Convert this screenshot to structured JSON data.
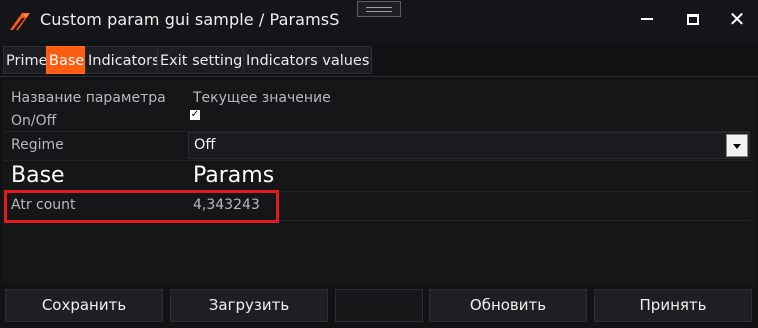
{
  "window": {
    "title": "Custom param gui sample / ParamsS",
    "colors": {
      "accent": "#ff5c11",
      "background": "#111214",
      "highlight_border": "#e11b20"
    },
    "icons": [
      "app-logo-icon",
      "drag-handle-icon",
      "minimize-icon",
      "maximize-icon",
      "close-icon"
    ]
  },
  "tabs": [
    {
      "label": "Prime",
      "active": false
    },
    {
      "label": "Base",
      "active": true
    },
    {
      "label": "Indicators",
      "active": false
    },
    {
      "label": "Exit settings",
      "active": false
    },
    {
      "label": "Indicators values",
      "active": false
    }
  ],
  "parameters": {
    "headers": {
      "name": "Название параметра",
      "value": "Текущее значение"
    },
    "on_off": {
      "label": "On/Off",
      "checked": true,
      "check_mark": "✓"
    },
    "regime": {
      "label": "Regime",
      "value": "Off"
    },
    "group": {
      "label": "Base",
      "value": "Params"
    },
    "atr_count": {
      "label": "Atr count",
      "value": "4,343243"
    }
  },
  "footer": {
    "save": "Сохранить",
    "load": "Загрузить",
    "refresh": "Обновить",
    "accept": "Принять"
  }
}
